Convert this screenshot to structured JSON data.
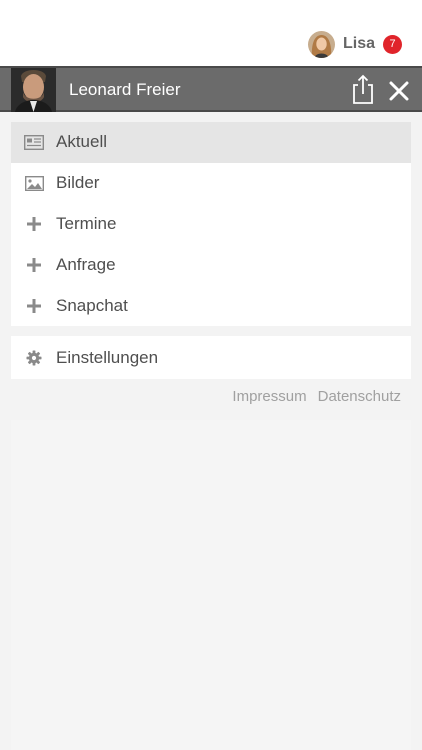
{
  "user": {
    "name": "Lisa",
    "badge_count": "7"
  },
  "profile": {
    "name": "Leonard Freier"
  },
  "menu": [
    {
      "label": "Aktuell",
      "icon": "newspaper-icon",
      "active": true
    },
    {
      "label": "Bilder",
      "icon": "image-icon",
      "active": false
    },
    {
      "label": "Termine",
      "icon": "plus-icon",
      "active": false
    },
    {
      "label": "Anfrage",
      "icon": "plus-icon",
      "active": false
    },
    {
      "label": "Snapchat",
      "icon": "plus-icon",
      "active": false
    }
  ],
  "settings": {
    "label": "Einstellungen",
    "icon": "gear-icon"
  },
  "footer": {
    "impressum": "Impressum",
    "datenschutz": "Datenschutz"
  },
  "colors": {
    "badge": "#e0242a",
    "profile_bar": "#6b6b6b",
    "active_item": "#e5e5e5"
  }
}
